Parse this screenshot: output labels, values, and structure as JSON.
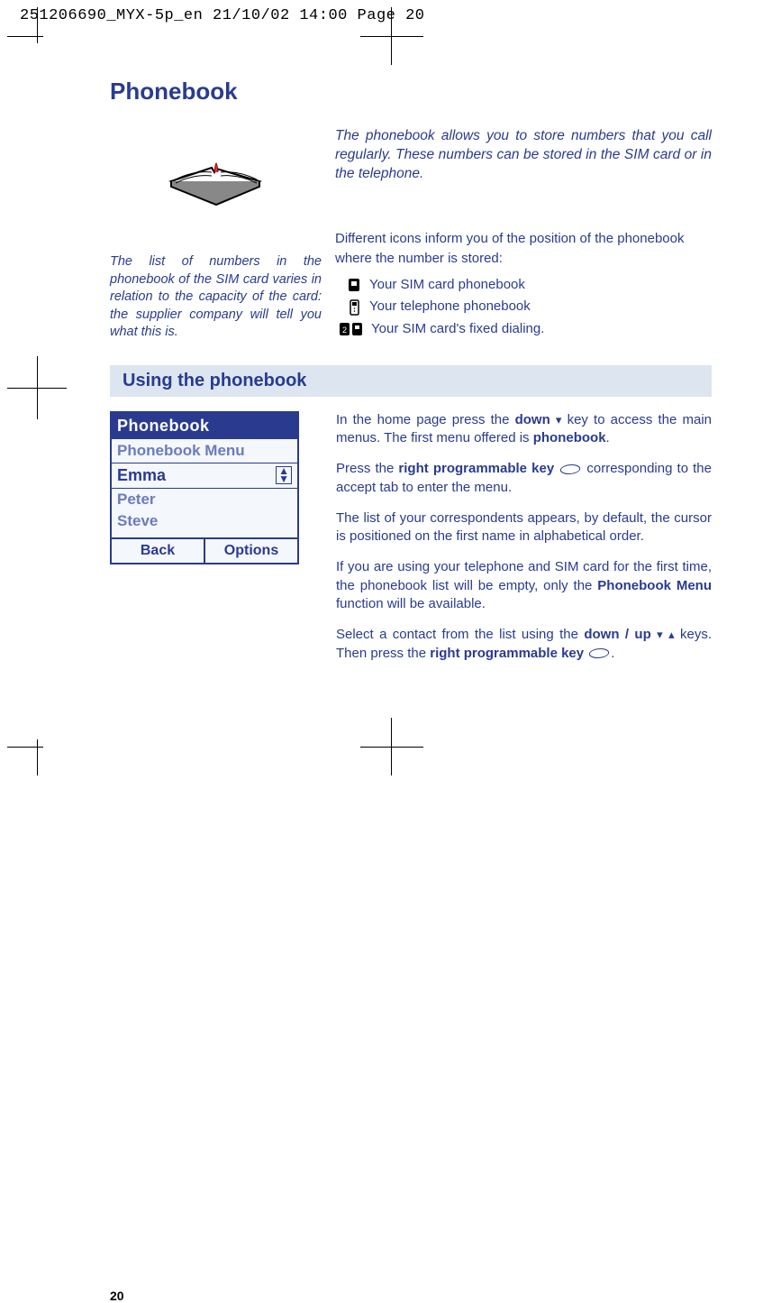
{
  "header": "251206690_MYX-5p_en  21/10/02  14:00  Page 20",
  "title": "Phonebook",
  "intro_right": "The phonebook allows you to store numbers that you call regularly. These numbers can be stored in the SIM card or in the telephone.",
  "left_note": "The list of numbers in the phonebook of the SIM card varies in relation to the capacity of the card: the supplier company will tell you what this is.",
  "icons_lead": "Different icons inform you of the position of the phonebook where the number is stored:",
  "icons": {
    "sim": "Your SIM card phonebook",
    "phone": "Your telephone phonebook",
    "fixed": "Your SIM card's fixed dialing."
  },
  "section": "Using the phonebook",
  "phone": {
    "title": "Phonebook",
    "menu": "Phonebook Menu",
    "selected": "Emma",
    "others": [
      "Peter",
      "Steve"
    ],
    "soft_left": "Back",
    "soft_right": "Options"
  },
  "body": {
    "p1a": "In the home page press the ",
    "p1b": "down",
    "p1c": " key to access the main menus. The first menu offered is ",
    "p1d": "phonebook",
    "p1e": ".",
    "p2a": "Press the ",
    "p2b": "right programmable key",
    "p2c": " corresponding to the accept tab to enter the menu.",
    "p3": "The list of your correspondents appears, by default, the cursor is positioned on the first name in alphabetical order.",
    "p4a": "If you are using your telephone and SIM card for the first time, the phonebook list will be empty, only the ",
    "p4b": "Phonebook Menu",
    "p4c": " function will be available.",
    "p5a": "Select a contact from the list using the ",
    "p5b": "down / up",
    "p5c": " keys. Then press the ",
    "p5d": "right programmable key",
    "p5e": "."
  },
  "page_number": "20"
}
